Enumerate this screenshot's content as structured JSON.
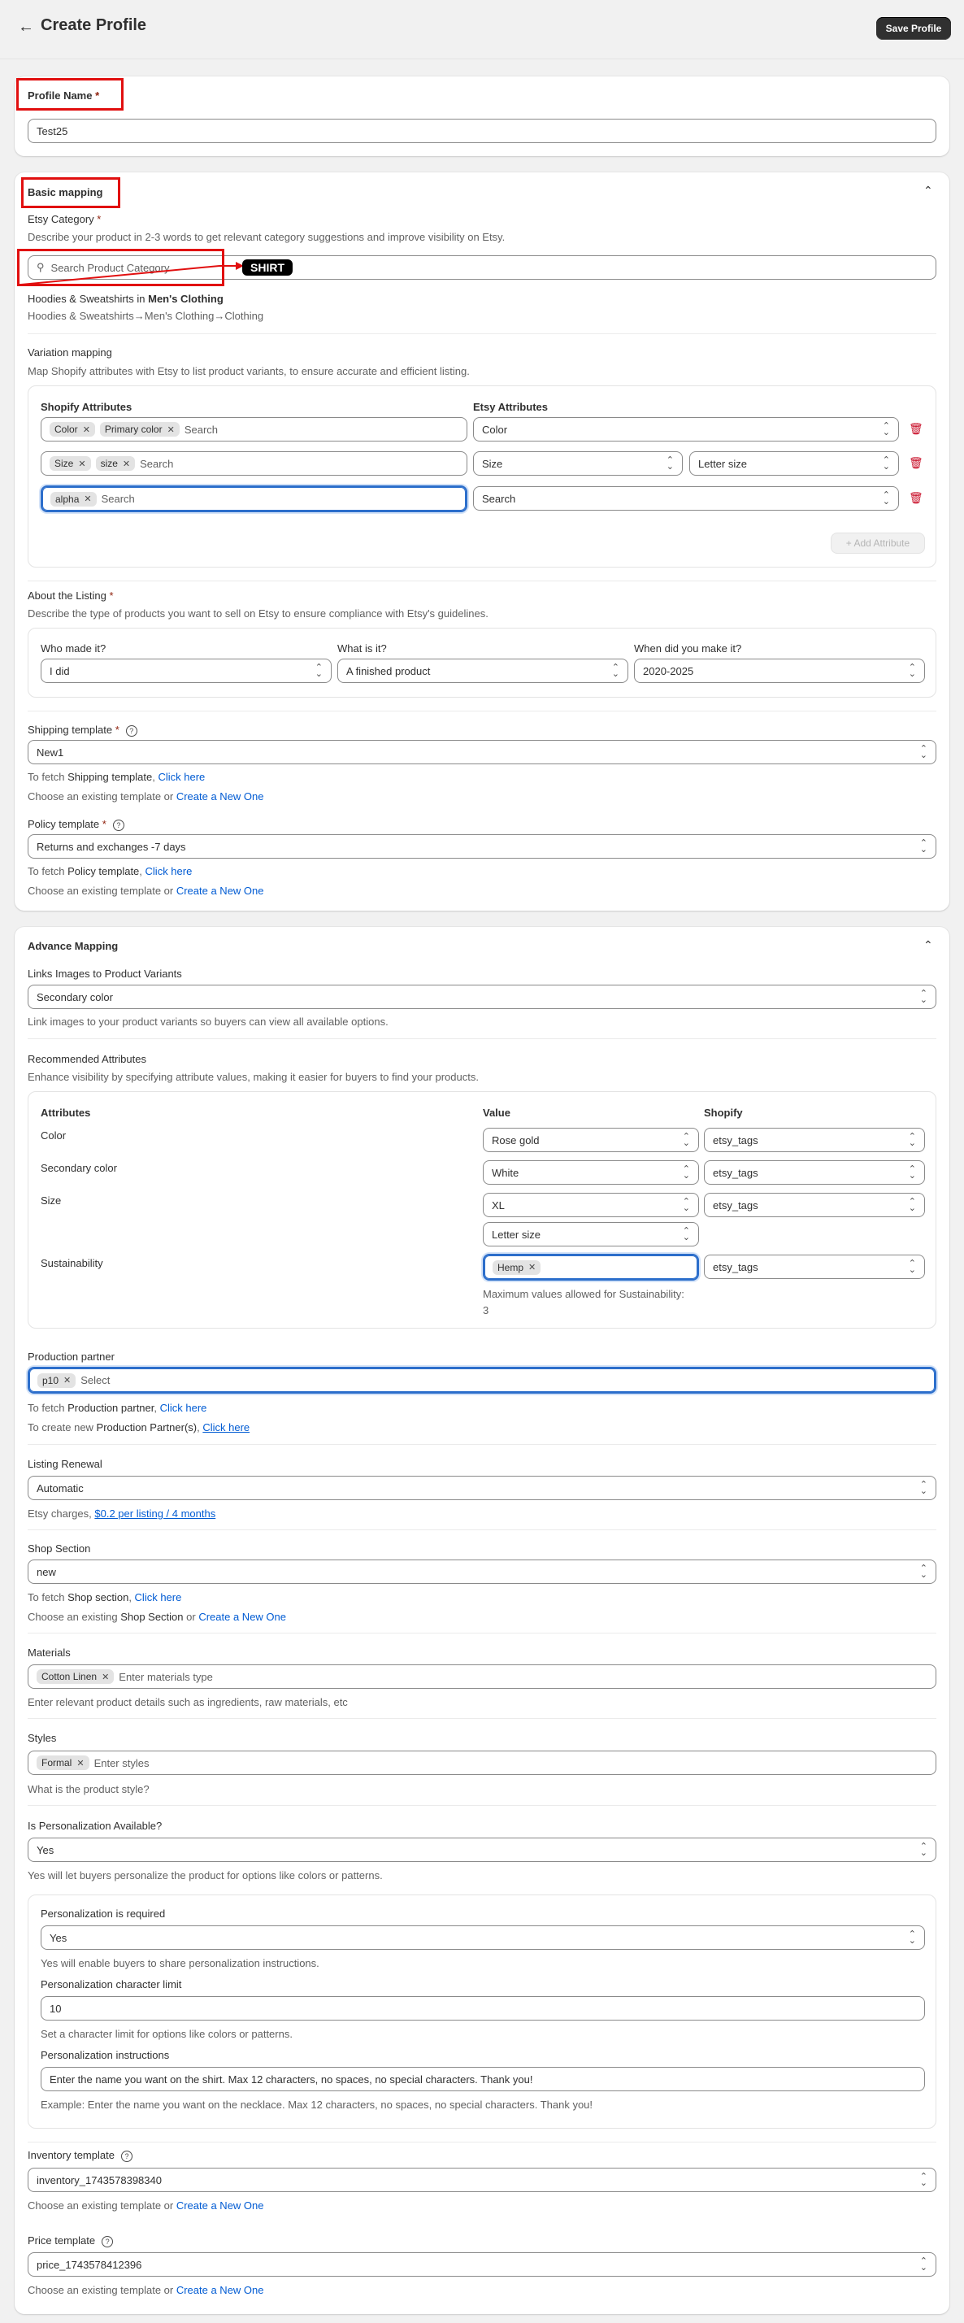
{
  "header": {
    "title": "Create Profile",
    "save_label": "Save Profile"
  },
  "profile": {
    "label": "Profile Name",
    "required": "*",
    "value": "Test25"
  },
  "basic": {
    "title": "Basic mapping",
    "category_label": "Etsy Category",
    "required": "*",
    "category_help": "Describe your product in 2-3 words to get relevant category suggestions and improve visibility on Etsy.",
    "search_placeholder": "Search Product Category",
    "annotation": "SHIRT",
    "result_prefix": "Hoodies & Sweatshirts in ",
    "result_bold": "Men's Clothing",
    "result_path": "Hoodies & Sweatshirts→Men's Clothing→Clothing",
    "variation_title": "Variation mapping",
    "variation_help": "Map Shopify attributes with Etsy to list product variants, to ensure accurate and efficient listing.",
    "shopify_col": "Shopify Attributes",
    "etsy_col": "Etsy Attributes",
    "search_placeholder_small": "Search",
    "rows": [
      {
        "tags": [
          "Color",
          "Primary color"
        ],
        "etsy": "Color"
      },
      {
        "tags": [
          "Size",
          "size"
        ],
        "etsy": "Size",
        "etsy2": "Letter size"
      },
      {
        "tags": [
          "alpha"
        ],
        "etsy": "Search"
      }
    ],
    "add_attribute": "+ Add Attribute",
    "about_title": "About the Listing",
    "about_help": "Describe the type of products you want to sell on Etsy to ensure compliance with Etsy's guidelines.",
    "who_label": "Who made it?",
    "who_value": "I did",
    "what_label": "What is it?",
    "what_value": "A finished product",
    "when_label": "When did you make it?",
    "when_value": "2020-2025",
    "shipping_label": "Shipping template",
    "shipping_value": "New1",
    "fetch_prefix": "To fetch ",
    "fetch_shipping": "Shipping template",
    "fetch_policy": "Policy template",
    "comma": ", ",
    "click_here": "Click here",
    "choose_existing": "Choose an existing template or ",
    "create_new": "Create a New One",
    "policy_label": "Policy template",
    "policy_value": "Returns and exchanges -7 days"
  },
  "advance": {
    "title": "Advance Mapping",
    "links_label": "Links Images to Product Variants",
    "links_value": "Secondary color",
    "links_help": "Link images to your product variants so buyers can view all available options.",
    "rec_title": "Recommended Attributes",
    "rec_help": "Enhance visibility by specifying attribute values, making it easier for buyers to find your products.",
    "col_attributes": "Attributes",
    "col_value": "Value",
    "col_shopify": "Shopify",
    "attrs": [
      {
        "name": "Color",
        "value": "Rose gold",
        "shopify": "etsy_tags"
      },
      {
        "name": "Secondary color",
        "value": "White",
        "shopify": "etsy_tags"
      },
      {
        "name": "Size",
        "value": "XL",
        "value2": "Letter size",
        "shopify": "etsy_tags"
      },
      {
        "name": "Sustainability",
        "tag": "Hemp",
        "shopify": "etsy_tags"
      }
    ],
    "max_note": "Maximum values allowed for Sustainability:",
    "max_value": "3",
    "prod_label": "Production partner",
    "prod_tag": "p10",
    "prod_placeholder": "Select",
    "prod_fetch_bold": "Production partner",
    "prod_create_prefix": "To create new ",
    "prod_create_bold": "Production Partner(s)",
    "renewal_label": "Listing Renewal",
    "renewal_value": "Automatic",
    "etsy_charges": "Etsy charges, ",
    "charges_link": "$0.2 per listing / 4 months",
    "shop_label": "Shop Section",
    "shop_value": "new",
    "fetch_shop": "Shop section",
    "choose_shop_prefix": "Choose an existing ",
    "choose_shop_bold": "Shop Section",
    "choose_shop_or": " or ",
    "materials_label": "Materials",
    "materials_tag": "Cotton Linen",
    "materials_placeholder": "Enter materials type",
    "materials_help": "Enter relevant product details such as ingredients, raw materials, etc",
    "styles_label": "Styles",
    "styles_tag": "Formal",
    "styles_placeholder": "Enter styles",
    "styles_help": "What is the product style?",
    "pers_label": "Is Personalization Available?",
    "pers_value": "Yes",
    "pers_help": "Yes will let buyers personalize the product for options like colors or patterns.",
    "pers_req_label": "Personalization is required",
    "pers_req_value": "Yes",
    "pers_req_help": "Yes will enable buyers to share personalization instructions.",
    "char_label": "Personalization character limit",
    "char_value": "10",
    "char_help": "Set a character limit for options like colors or patterns.",
    "instr_label": "Personalization instructions",
    "instr_value": "Enter the name you want on the shirt. Max 12 characters, no spaces, no special characters. Thank you!",
    "instr_help": "Example: Enter the name you want on the necklace. Max 12 characters, no spaces, no special characters. Thank you!",
    "inv_label": "Inventory template",
    "inv_value": "inventory_1743578398340",
    "price_label": "Price template",
    "price_value": "price_1743578412396"
  }
}
